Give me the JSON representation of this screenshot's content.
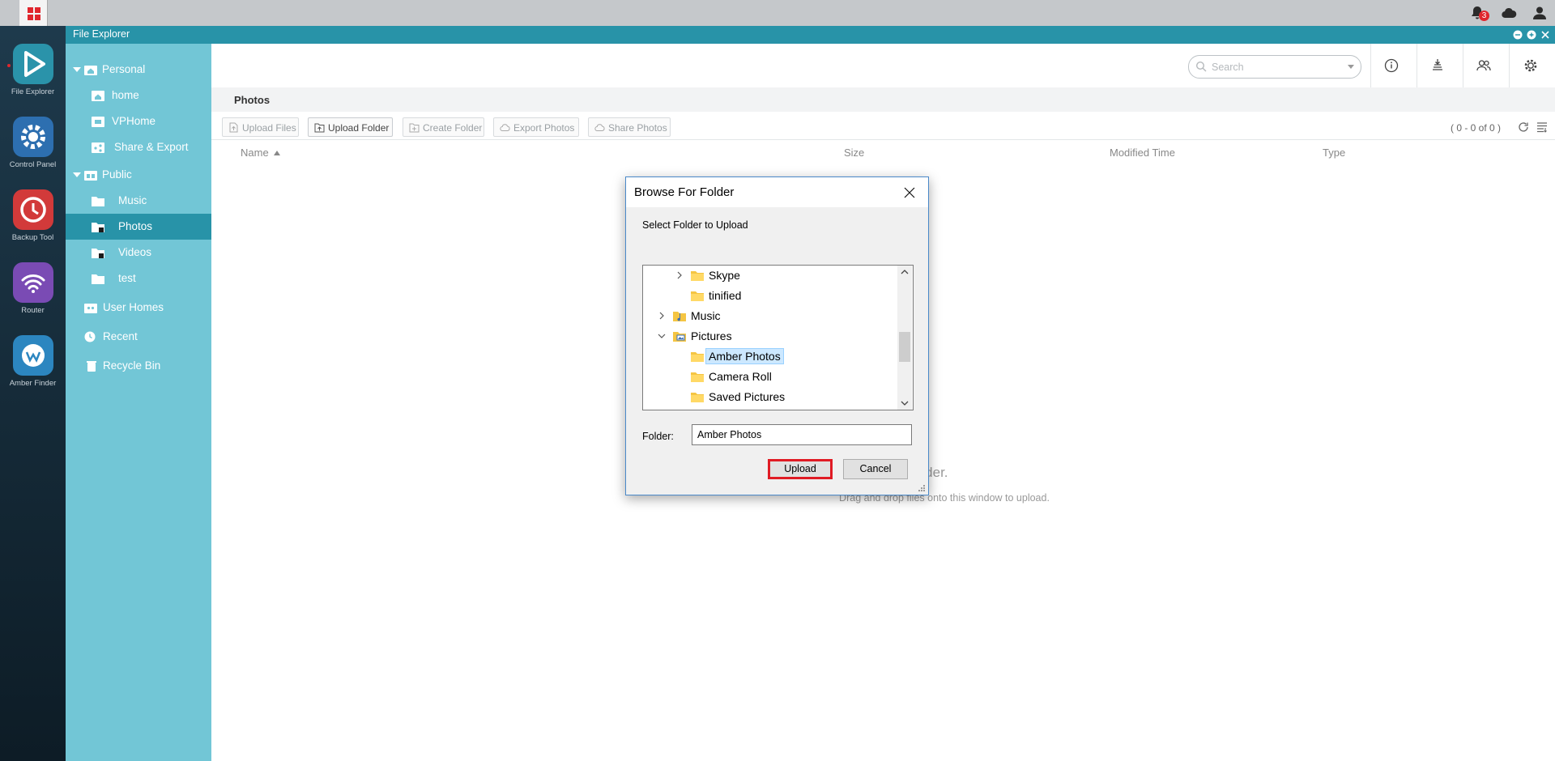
{
  "topbar": {
    "notification_count": "3"
  },
  "dock": [
    {
      "label": "File Explorer",
      "color": "#2a93aa"
    },
    {
      "label": "Control Panel",
      "color": "#2d6fb0"
    },
    {
      "label": "Backup Tool",
      "color": "#d23a3a"
    },
    {
      "label": "Router",
      "color": "#7a4bb4"
    },
    {
      "label": "Amber Finder",
      "color": "#2c86c0"
    }
  ],
  "window": {
    "title": "File Explorer"
  },
  "sidebar": {
    "items": [
      {
        "label": "Personal"
      },
      {
        "label": "home"
      },
      {
        "label": "VPHome"
      },
      {
        "label": "Share & Export"
      },
      {
        "label": "Public"
      },
      {
        "label": "Music"
      },
      {
        "label": "Photos"
      },
      {
        "label": "Videos"
      },
      {
        "label": "test"
      },
      {
        "label": "User Homes"
      },
      {
        "label": "Recent"
      },
      {
        "label": "Recycle Bin"
      }
    ]
  },
  "header": {
    "search_placeholder": "Search"
  },
  "breadcrumb": {
    "current": "Photos"
  },
  "toolbar": {
    "upload_files": "Upload Files",
    "upload_folder": "Upload Folder",
    "create_folder": "Create Folder",
    "export_photos": "Export Photos",
    "share_photos": "Share Photos",
    "count": "( 0 - 0 of 0 )"
  },
  "columns": {
    "name": "Name",
    "size": "Size",
    "modified": "Modified Time",
    "type": "Type"
  },
  "empty_state": {
    "line1": "s folder.",
    "line2": "Drag and drop files onto this window to upload."
  },
  "dialog": {
    "title": "Browse For Folder",
    "subtitle": "Select Folder to Upload",
    "tree": [
      {
        "label": "Skype"
      },
      {
        "label": "tinified"
      },
      {
        "label": "Music"
      },
      {
        "label": "Pictures"
      },
      {
        "label": "Amber Photos"
      },
      {
        "label": "Camera Roll"
      },
      {
        "label": "Saved Pictures"
      }
    ],
    "folder_label": "Folder:",
    "folder_value": "Amber Photos",
    "upload_label": "Upload",
    "cancel_label": "Cancel"
  },
  "colors": {
    "accent": "#2893a8",
    "sidebar": "#72c6d6",
    "highlight": "#e01b24"
  }
}
